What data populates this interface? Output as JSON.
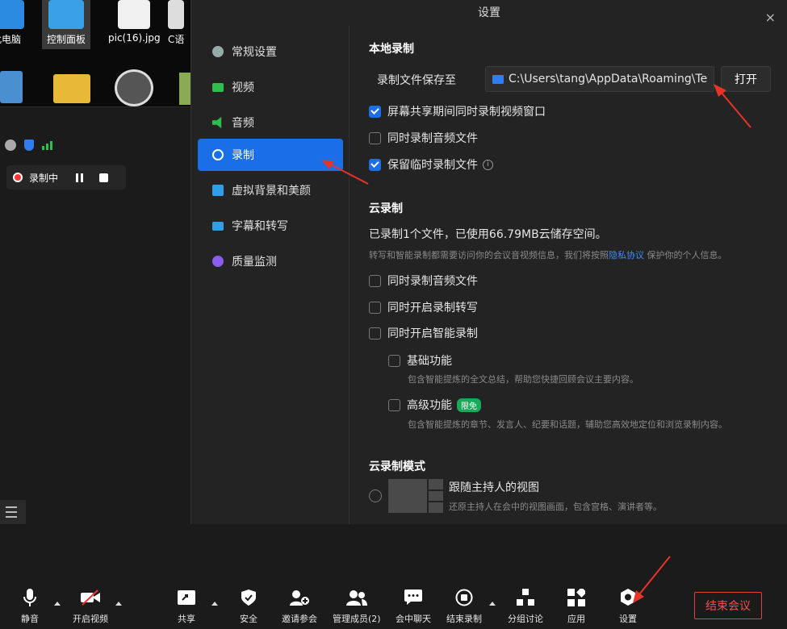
{
  "desktop": {
    "icons": [
      {
        "label": "此电脑"
      },
      {
        "label": "控制面板"
      },
      {
        "label": "pic(16).jpg"
      },
      {
        "label": "C语"
      }
    ]
  },
  "meeting": {
    "rec_status": "录制中"
  },
  "dialog": {
    "title": "设置",
    "close": "×",
    "nav": [
      {
        "label": "常规设置",
        "icon": "gear-icon"
      },
      {
        "label": "视频",
        "icon": "camera-icon"
      },
      {
        "label": "音频",
        "icon": "speaker-icon"
      },
      {
        "label": "录制",
        "icon": "record-icon",
        "active": true
      },
      {
        "label": "虚拟背景和美颜",
        "icon": "portrait-icon"
      },
      {
        "label": "字幕和转写",
        "icon": "caption-icon"
      },
      {
        "label": "质量监测",
        "icon": "monitor-icon"
      }
    ],
    "local": {
      "title": "本地录制",
      "save_label": "录制文件保存至",
      "path": "C:\\Users\\tang\\AppData\\Roaming\\Te",
      "open_btn": "打开",
      "options": [
        {
          "label": "屏幕共享期间同时录制视频窗口",
          "checked": true
        },
        {
          "label": "同时录制音频文件",
          "checked": false
        },
        {
          "label": "保留临时录制文件",
          "checked": true
        }
      ]
    },
    "cloud": {
      "title": "云录制",
      "usage": "已录制1个文件，已使用66.79MB云储存空间。",
      "notice_pre": "转写和智能录制都需要访问你的会议音视频信息，我们将按照",
      "notice_link": "隐私协议",
      "notice_post": "保护你的个人信息。",
      "options": [
        {
          "label": "同时录制音频文件",
          "checked": false
        },
        {
          "label": "同时开启录制转写",
          "checked": false
        },
        {
          "label": "同时开启智能录制",
          "checked": false
        }
      ],
      "basic": {
        "label": "基础功能",
        "desc": "包含智能提炼的全文总结，帮助您快捷回顾会议主要内容。"
      },
      "advanced": {
        "label": "高级功能",
        "badge": "限免",
        "desc": "包含智能提炼的章节、发言人、纪要和话题，辅助您高效地定位和浏览录制内容。"
      }
    },
    "mode": {
      "title": "云录制模式",
      "option_label": "跟随主持人的视图",
      "option_desc": "还原主持人在会中的视图画面，包含宫格、演讲者等。"
    }
  },
  "toolbar": {
    "items": [
      {
        "label": "静音",
        "icon": "microphone-icon"
      },
      {
        "label": "开启视频",
        "icon": "camera-off-icon"
      },
      {
        "label": "共享",
        "icon": "share-icon"
      },
      {
        "label": "安全",
        "icon": "shield-icon"
      },
      {
        "label": "邀请参会",
        "icon": "invite-icon"
      },
      {
        "label": "管理成员(2)",
        "icon": "members-icon"
      },
      {
        "label": "会中聊天",
        "icon": "chat-icon"
      },
      {
        "label": "结束录制",
        "icon": "stop-record-icon"
      },
      {
        "label": "分组讨论",
        "icon": "breakout-icon"
      },
      {
        "label": "应用",
        "icon": "apps-icon"
      },
      {
        "label": "设置",
        "icon": "settings-icon"
      }
    ],
    "end_label": "结束会议"
  },
  "colors": {
    "accent": "#1a6fe8",
    "danger": "#e04040",
    "badge": "#1aa85a",
    "annotation": "#e8332a"
  }
}
